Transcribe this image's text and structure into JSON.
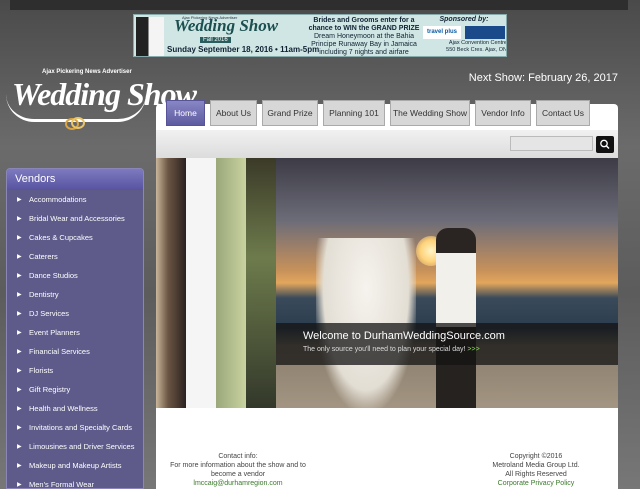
{
  "banner": {
    "publisher": "Ajax Pickering News Advertiser",
    "title": "Wedding Show",
    "season": "Fall 2016",
    "date_line": "Sunday September 18, 2016 • 11am-5pm",
    "promo_line1": "Brides and Grooms enter for a chance to WIN the GRAND PRIZE",
    "promo_line2": "Dream Honeymoon at the Bahia Principe Runaway Bay in Jamaica including 7 nights and airfare",
    "sponsored_by": "Sponsored by:",
    "sponsor_logo": "travel plus",
    "venue_line1": "Ajax Convention Centre",
    "venue_line2": "550 Beck Cres. Ajax, ON"
  },
  "logo": {
    "publisher": "Ajax Pickering News Advertiser",
    "title": "Wedding Show"
  },
  "next_show": "Next Show: February 26, 2017",
  "nav": {
    "tabs": [
      "Home",
      "About Us",
      "Grand Prize",
      "Planning 101",
      "The Wedding Show",
      "Vendor Info",
      "Contact Us"
    ],
    "active": "Home"
  },
  "search": {
    "placeholder": ""
  },
  "sidebar": {
    "heading": "Vendors",
    "items": [
      "Accommodations",
      "Bridal Wear and Accessories",
      "Cakes & Cupcakes",
      "Caterers",
      "Dance Studios",
      "Dentistry",
      "DJ Services",
      "Event Planners",
      "Financial Services",
      "Florists",
      "Gift Registry",
      "Health and Wellness",
      "Invitations and Specialty Cards",
      "Limousines and Driver Services",
      "Makeup and Makeup Artists",
      "Men's Formal Wear"
    ]
  },
  "hero": {
    "title": "Welcome to DurhamWeddingSource.com",
    "subtitle": "The only source you'll need to plan your special day!",
    "more": ">>>"
  },
  "footer": {
    "contact_heading": "Contact info:",
    "contact_text": "For more information about the show and to become a vendor",
    "contact_email": "lmccaig@durhamregion.com",
    "copyright": "Copyright ©2016",
    "company": "Metroland Media Group Ltd.",
    "rights": "All Rights Reserved",
    "privacy": "Corporate Privacy Policy"
  },
  "colors": {
    "tab_active": "#5e5ba0",
    "sidebar": "#5e5b8a",
    "link": "#3a7a2a",
    "more_link": "#8fe25a"
  }
}
